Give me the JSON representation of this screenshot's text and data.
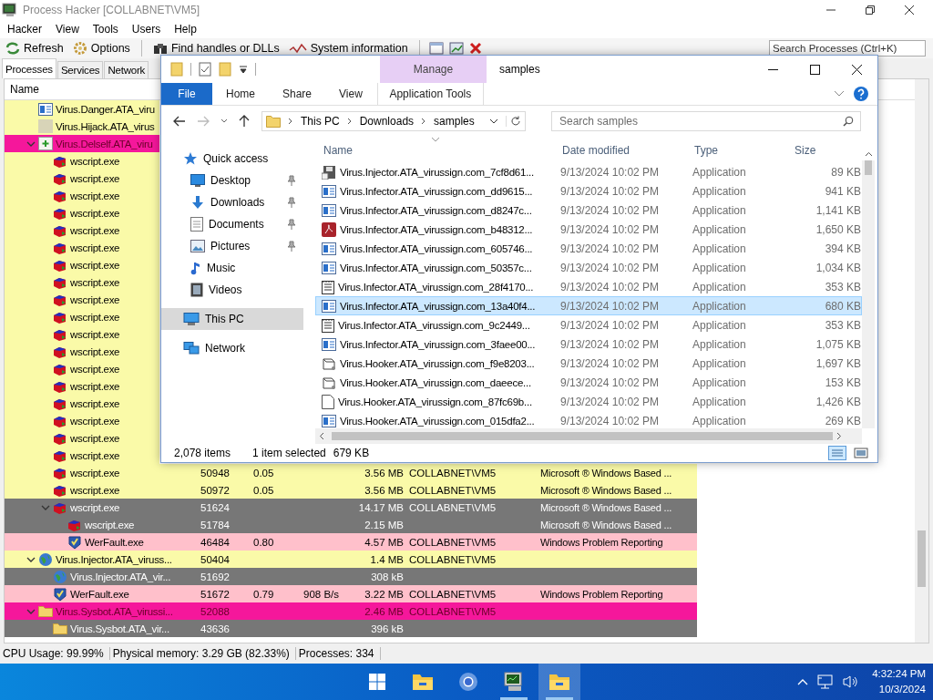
{
  "process_hacker": {
    "title": "Process Hacker [COLLABNET\\VM5]",
    "menu": [
      "Hacker",
      "View",
      "Tools",
      "Users",
      "Help"
    ],
    "toolbar": [
      {
        "label": "Refresh",
        "kind": "refresh"
      },
      {
        "label": "Options",
        "kind": "options"
      },
      {
        "label": "Find handles or DLLs",
        "kind": "find"
      },
      {
        "label": "System information",
        "kind": "sysinfo"
      }
    ],
    "search": {
      "placeholder": "Search Processes (Ctrl+K)"
    },
    "tabs": [
      {
        "label": "Processes",
        "selected": true
      },
      {
        "label": "Services",
        "selected": false
      },
      {
        "label": "Network",
        "selected": false
      }
    ],
    "tree": {
      "columns": [
        "Name"
      ],
      "processes": [
        {
          "name": "Virus.Danger.ATA_viru",
          "kind": "app",
          "color": "#fafaa8"
        },
        {
          "name": "Virus.Hijack.ATA_virus",
          "kind": "blank",
          "color": "#fafaa8"
        },
        {
          "name": "Virus.Delself.ATA_viru",
          "kind": "installer",
          "color": "#f5179b",
          "expanded": true,
          "children": [
            {
              "name": "wscript.exe",
              "kind": "script",
              "color": "#fafaa8"
            },
            {
              "name": "wscript.exe",
              "kind": "script",
              "color": "#fafaa8"
            },
            {
              "name": "wscript.exe",
              "kind": "script",
              "color": "#fafaa8"
            },
            {
              "name": "wscript.exe",
              "kind": "script",
              "color": "#fafaa8"
            },
            {
              "name": "wscript.exe",
              "kind": "script",
              "color": "#fafaa8"
            },
            {
              "name": "wscript.exe",
              "kind": "script",
              "color": "#fafaa8"
            },
            {
              "name": "wscript.exe",
              "kind": "script",
              "color": "#fafaa8"
            },
            {
              "name": "wscript.exe",
              "kind": "script",
              "color": "#fafaa8"
            },
            {
              "name": "wscript.exe",
              "kind": "script",
              "color": "#fafaa8"
            },
            {
              "name": "wscript.exe",
              "kind": "script",
              "color": "#fafaa8"
            },
            {
              "name": "wscript.exe",
              "kind": "script",
              "color": "#fafaa8"
            },
            {
              "name": "wscript.exe",
              "kind": "script",
              "color": "#fafaa8"
            },
            {
              "name": "wscript.exe",
              "kind": "script",
              "color": "#fafaa8"
            },
            {
              "name": "wscript.exe",
              "kind": "script",
              "color": "#fafaa8"
            },
            {
              "name": "wscript.exe",
              "kind": "script",
              "color": "#fafaa8"
            },
            {
              "name": "wscript.exe",
              "kind": "script",
              "color": "#fafaa8"
            },
            {
              "name": "wscript.exe",
              "kind": "script",
              "color": "#fafaa8"
            },
            {
              "name": "wscript.exe",
              "kind": "script",
              "color": "#fafaa8"
            },
            {
              "name": "wscript.exe",
              "kind": "script",
              "color": "#fafaa8",
              "pid": "50948",
              "cpu": "0.05",
              "private_bytes": "3.56 MB",
              "user": "COLLABNET\\VM5",
              "description": "Microsoft ® Windows Based ..."
            },
            {
              "name": "wscript.exe",
              "kind": "script",
              "color": "#fafaa8",
              "pid": "50972",
              "cpu": "0.05",
              "private_bytes": "3.56 MB",
              "user": "COLLABNET\\VM5",
              "description": "Microsoft ® Windows Based ..."
            },
            {
              "name": "wscript.exe",
              "kind": "script",
              "color": "#777777",
              "pid": "51624",
              "private_bytes": "14.17 MB",
              "user": "COLLABNET\\VM5",
              "description": "Microsoft ® Windows Based ...",
              "expanded": true,
              "children": [
                {
                  "name": "wscript.exe",
                  "kind": "script",
                  "color": "#777777",
                  "pid": "51784",
                  "private_bytes": "2.15 MB",
                  "description": "Microsoft ® Windows Based ..."
                },
                {
                  "name": "WerFault.exe",
                  "kind": "report",
                  "color": "#ffc0cb",
                  "pid": "46484",
                  "cpu": "0.80",
                  "private_bytes": "4.57 MB",
                  "user": "COLLABNET\\VM5",
                  "description": "Windows Problem Reporting"
                }
              ]
            }
          ]
        },
        {
          "name": "Virus.Injector.ATA_viruss...",
          "kind": "globe",
          "color": "#fafaa8",
          "pid": "50404",
          "private_bytes": "1.4 MB",
          "user": "COLLABNET\\VM5",
          "expanded": true,
          "children": [
            {
              "name": "Virus.Injector.ATA_vir...",
              "kind": "globe",
              "color": "#777777",
              "pid": "51692",
              "private_bytes": "308 kB"
            },
            {
              "name": "WerFault.exe",
              "kind": "report",
              "color": "#ffc0cb",
              "pid": "51672",
              "cpu": "0.79",
              "io": "908 B/s",
              "private_bytes": "3.22 MB",
              "user": "COLLABNET\\VM5",
              "description": "Windows Problem Reporting"
            }
          ]
        },
        {
          "name": "Virus.Sysbot.ATA_virussi...",
          "kind": "folder",
          "color": "#f5179b",
          "pid": "52088",
          "private_bytes": "2.46 MB",
          "user": "COLLABNET\\VM5",
          "expanded": true,
          "children": [
            {
              "name": "Virus.Sysbot.ATA_vir...",
              "kind": "folder",
              "color": "#777777",
              "pid": "43636",
              "private_bytes": "396 kB"
            }
          ]
        }
      ]
    },
    "status_bar": [
      "CPU Usage: 99.99%",
      "Physical memory: 3.29 GB (82.33%)",
      "Processes: 334"
    ]
  },
  "explorer": {
    "title": "samples",
    "context_tab": "Manage",
    "ribbon_tabs": [
      {
        "label": "File",
        "kind": "file"
      },
      {
        "label": "Home",
        "kind": "tab"
      },
      {
        "label": "Share",
        "kind": "tab"
      },
      {
        "label": "View",
        "kind": "tab"
      },
      {
        "label": "Application Tools",
        "kind": "context"
      }
    ],
    "path": [
      "This PC",
      "Downloads",
      "samples"
    ],
    "search": {
      "placeholder": "Search samples"
    },
    "nav": [
      {
        "label": "Quick access",
        "kind": "star",
        "selected": false,
        "children": [
          {
            "label": "Desktop",
            "kind": "desktop",
            "pinned": true,
            "selected": false
          },
          {
            "label": "Downloads",
            "kind": "download",
            "pinned": true,
            "selected": false
          },
          {
            "label": "Documents",
            "kind": "documents",
            "pinned": true,
            "selected": false
          },
          {
            "label": "Pictures",
            "kind": "pictures",
            "pinned": true,
            "selected": false
          },
          {
            "label": "Music",
            "kind": "music",
            "pinned": false,
            "selected": false
          },
          {
            "label": "Videos",
            "kind": "videos",
            "pinned": false,
            "selected": false
          }
        ]
      },
      {
        "label": "This PC",
        "kind": "pc",
        "selected": true
      },
      {
        "label": "Network",
        "kind": "network",
        "selected": false
      }
    ],
    "columns": [
      "Name",
      "Date modified",
      "Type",
      "Size"
    ],
    "files": [
      {
        "name": "Virus.Injector.ATA_virussign.com_7cf8d61...",
        "date": "9/13/2024 10:02 PM",
        "type": "Application",
        "size": "89 KB",
        "kind": "installer",
        "selected": false
      },
      {
        "name": "Virus.Infector.ATA_virussign.com_dd9615...",
        "date": "9/13/2024 10:02 PM",
        "type": "Application",
        "size": "941 KB",
        "kind": "app",
        "selected": false
      },
      {
        "name": "Virus.Infector.ATA_virussign.com_d8247c...",
        "date": "9/13/2024 10:02 PM",
        "type": "Application",
        "size": "1,141 KB",
        "kind": "app",
        "selected": false
      },
      {
        "name": "Virus.Infector.ATA_virussign.com_b48312...",
        "date": "9/13/2024 10:02 PM",
        "type": "Application",
        "size": "1,650 KB",
        "kind": "pdf",
        "selected": false
      },
      {
        "name": "Virus.Infector.ATA_virussign.com_605746...",
        "date": "9/13/2024 10:02 PM",
        "type": "Application",
        "size": "394 KB",
        "kind": "app",
        "selected": false
      },
      {
        "name": "Virus.Infector.ATA_virussign.com_50357c...",
        "date": "9/13/2024 10:02 PM",
        "type": "Application",
        "size": "1,034 KB",
        "kind": "app",
        "selected": false
      },
      {
        "name": "Virus.Infector.ATA_virussign.com_28f4170...",
        "date": "9/13/2024 10:02 PM",
        "type": "Application",
        "size": "353 KB",
        "kind": "notepad",
        "selected": false
      },
      {
        "name": "Virus.Infector.ATA_virussign.com_13a40f4...",
        "date": "9/13/2024 10:02 PM",
        "type": "Application",
        "size": "680 KB",
        "kind": "app",
        "selected": true
      },
      {
        "name": "Virus.Infector.ATA_virussign.com_9c2449...",
        "date": "9/13/2024 10:02 PM",
        "type": "Application",
        "size": "353 KB",
        "kind": "notepad",
        "selected": false
      },
      {
        "name": "Virus.Infector.ATA_virussign.com_3faee00...",
        "date": "9/13/2024 10:02 PM",
        "type": "Application",
        "size": "1,075 KB",
        "kind": "app",
        "selected": false
      },
      {
        "name": "Virus.Hooker.ATA_virussign.com_f9e8203...",
        "date": "9/13/2024 10:02 PM",
        "type": "Application",
        "size": "1,697 KB",
        "kind": "box",
        "selected": false
      },
      {
        "name": "Virus.Hooker.ATA_virussign.com_daeece...",
        "date": "9/13/2024 10:02 PM",
        "type": "Application",
        "size": "153 KB",
        "kind": "box",
        "selected": false
      },
      {
        "name": "Virus.Hooker.ATA_virussign.com_87fc69b...",
        "date": "9/13/2024 10:02 PM",
        "type": "Application",
        "size": "1,426 KB",
        "kind": "page",
        "selected": false
      },
      {
        "name": "Virus.Hooker.ATA_virussign.com_015dfa2...",
        "date": "9/13/2024 10:02 PM",
        "type": "Application",
        "size": "269 KB",
        "kind": "app",
        "selected": false
      }
    ],
    "item_count": "2,078 items",
    "selection": "1 item selected",
    "selection_size": "679 KB"
  },
  "taskbar": {
    "apps": [
      {
        "kind": "start",
        "running": false,
        "active": false
      },
      {
        "kind": "folder",
        "running": false,
        "active": false
      },
      {
        "kind": "browser",
        "running": false,
        "active": false
      },
      {
        "kind": "monitor",
        "running": true,
        "active": false
      },
      {
        "kind": "folder",
        "running": true,
        "active": true
      }
    ],
    "time": "4:32:24 PM",
    "date": "10/3/2024"
  }
}
